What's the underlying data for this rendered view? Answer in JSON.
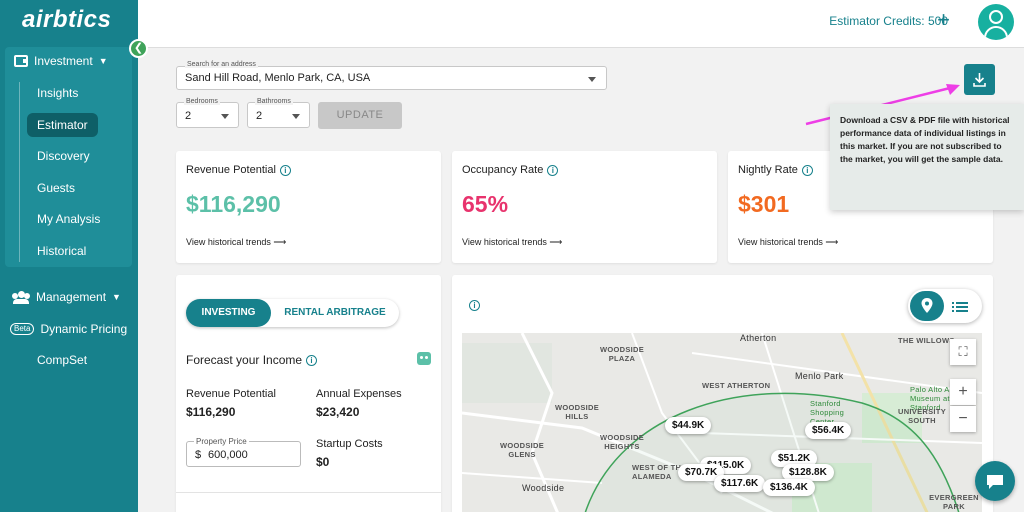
{
  "sidebar": {
    "logo": "airbtics",
    "investment_label": "Investment",
    "items": [
      {
        "label": "Insights"
      },
      {
        "label": "Estimator"
      },
      {
        "label": "Discovery"
      },
      {
        "label": "Guests"
      },
      {
        "label": "My Analysis"
      },
      {
        "label": "Historical"
      }
    ],
    "management_label": "Management",
    "beta_badge": "Beta",
    "dynamic_pricing_label": "Dynamic Pricing",
    "compset_label": "CompSet"
  },
  "header": {
    "credits": "Estimator Credits: 500"
  },
  "search": {
    "label": "Search for an address",
    "value": "Sand Hill Road, Menlo Park, CA, USA"
  },
  "filters": {
    "bedrooms_label": "Bedrooms",
    "bedrooms_value": "2",
    "bathrooms_label": "Bathrooms",
    "bathrooms_value": "2",
    "update_label": "UPDATE"
  },
  "download_tooltip": "Download a CSV & PDF file with historical performance data of individual listings in this market. If you are not subscribed to the market, you will get the sample data.",
  "metrics": [
    {
      "title": "Revenue Potential",
      "value": "$116,290",
      "link": "View historical trends",
      "color": "#5cc0a8"
    },
    {
      "title": "Occupancy Rate",
      "value": "65%",
      "link": "View historical trends",
      "color": "#e8336d"
    },
    {
      "title": "Nightly Rate",
      "value": "$301",
      "link": "View historical trends",
      "color": "#f26a21"
    }
  ],
  "forecast": {
    "tab_investing": "INVESTING",
    "tab_arbitrage": "RENTAL ARBITRAGE",
    "title": "Forecast your Income",
    "revenue_label": "Revenue Potential",
    "revenue_value": "$116,290",
    "expenses_label": "Annual Expenses",
    "expenses_value": "$23,420",
    "property_price_label": "Property Price",
    "property_price_prefix": "$",
    "property_price_value": "600,000",
    "startup_label": "Startup Costs",
    "startup_value": "$0"
  },
  "map": {
    "labels": [
      "Atherton",
      "WOODSIDE PLAZA",
      "THE WILLOWS",
      "Menlo Park",
      "WEST ATHERTON",
      "Palo Alto Art Museum at Stanford",
      "UNIVERSITY SOUTH",
      "WOODSIDE HILLS",
      "WOODSIDE HEIGHTS",
      "WOODSIDE GLENS",
      "Stanford Shopping Center",
      "WEST OF THE ALAMEDA",
      "Woodside",
      "EVERGREEN PARK"
    ],
    "prices": [
      "$44.9K",
      "$56.4K",
      "$51.2K",
      "$128.8K",
      "$70.7K",
      "$115.0K",
      "$117.6K",
      "$136.4K"
    ]
  }
}
